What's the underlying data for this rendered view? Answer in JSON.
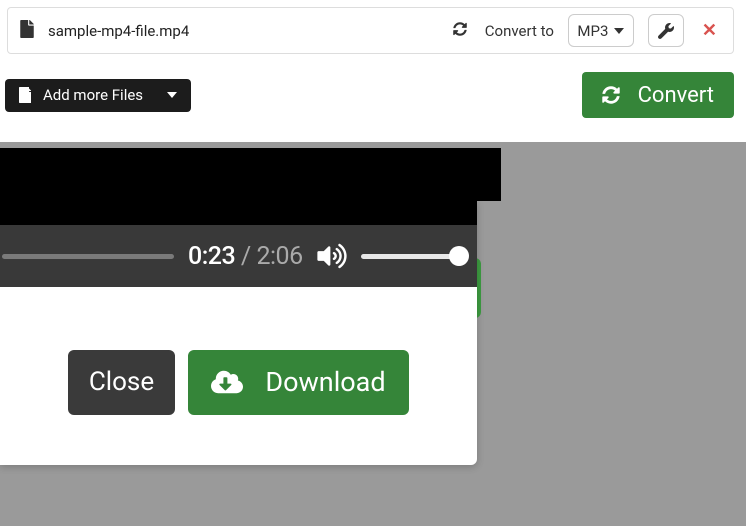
{
  "file": {
    "name": "sample-mp4-file.mp4",
    "convert_to_label": "Convert to",
    "format": "MP3"
  },
  "toolbar": {
    "add_files_label": "Add more Files",
    "convert_label": "Convert"
  },
  "player": {
    "current_time": "0:23",
    "separator": " / ",
    "total_time": "2:06"
  },
  "modal": {
    "close_label": "Close",
    "download_label": "Download"
  }
}
